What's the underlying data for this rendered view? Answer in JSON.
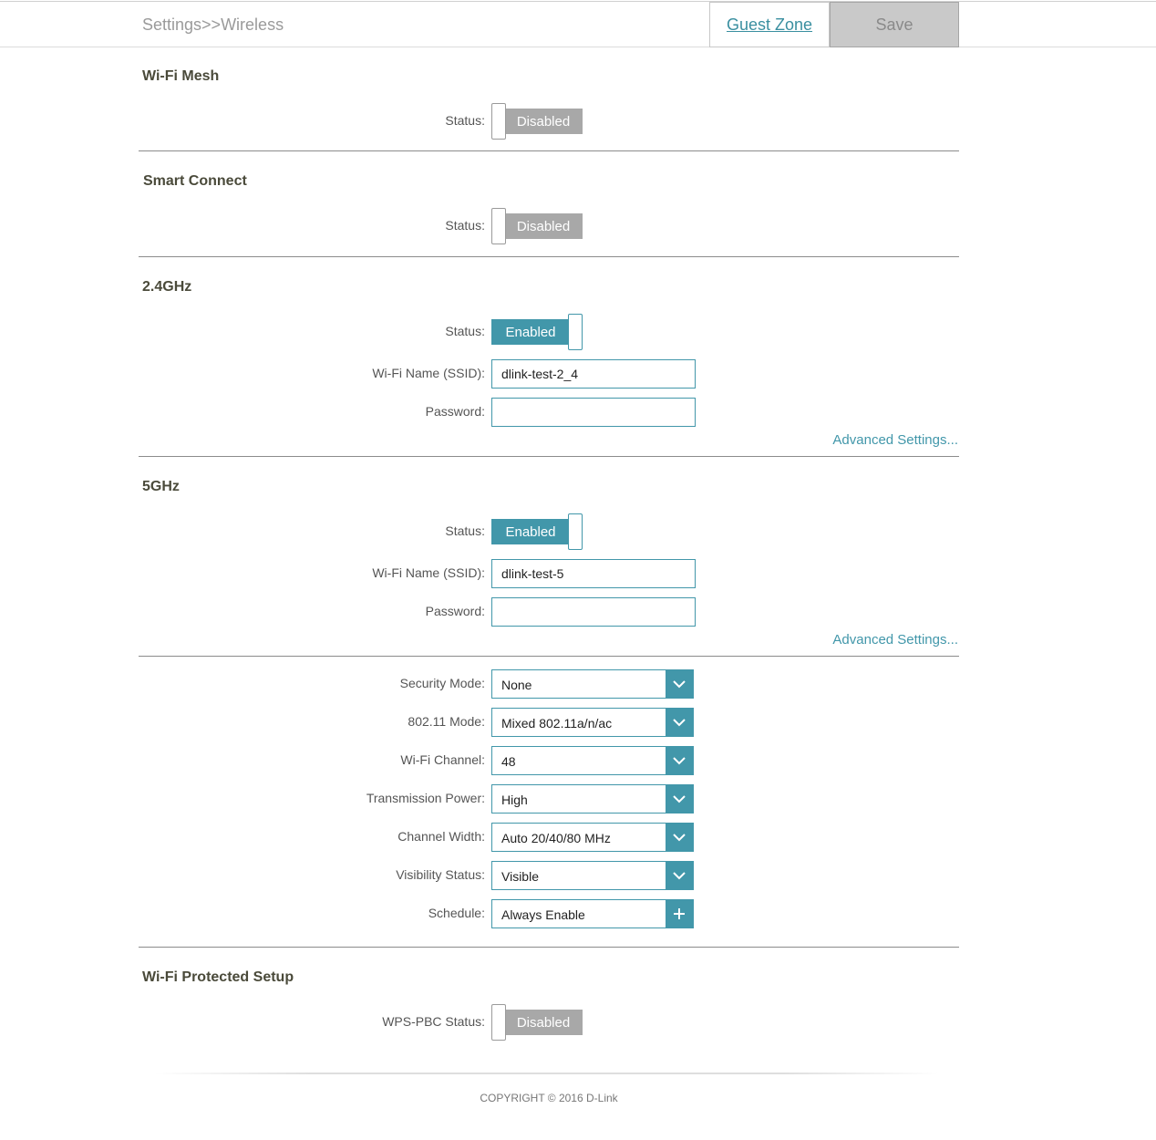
{
  "header": {
    "breadcrumb": "Settings>>Wireless",
    "guest_zone_label": "Guest Zone",
    "save_label": "Save"
  },
  "wifi_mesh": {
    "title": "Wi-Fi Mesh",
    "status_label": "Status:",
    "status_value": "Disabled"
  },
  "smart_connect": {
    "title": "Smart Connect",
    "status_label": "Status:",
    "status_value": "Disabled"
  },
  "band_24": {
    "title": "2.4GHz",
    "status_label": "Status:",
    "status_value": "Enabled",
    "ssid_label": "Wi-Fi Name (SSID):",
    "ssid_value": "dlink-test-2_4",
    "password_label": "Password:",
    "password_value": "",
    "advanced_label": "Advanced Settings..."
  },
  "band_5": {
    "title": "5GHz",
    "status_label": "Status:",
    "status_value": "Enabled",
    "ssid_label": "Wi-Fi Name (SSID):",
    "ssid_value": "dlink-test-5",
    "password_label": "Password:",
    "password_value": "",
    "advanced_label": "Advanced Settings..."
  },
  "advanced_5g": {
    "security_mode_label": "Security Mode:",
    "security_mode_value": "None",
    "mode_80211_label": "802.11 Mode:",
    "mode_80211_value": "Mixed 802.11a/n/ac",
    "channel_label": "Wi-Fi Channel:",
    "channel_value": "48",
    "tx_power_label": "Transmission Power:",
    "tx_power_value": "High",
    "channel_width_label": "Channel Width:",
    "channel_width_value": "Auto 20/40/80 MHz",
    "visibility_label": "Visibility Status:",
    "visibility_value": "Visible",
    "schedule_label": "Schedule:",
    "schedule_value": "Always Enable"
  },
  "wps": {
    "title": "Wi-Fi Protected Setup",
    "status_label": "WPS-PBC Status:",
    "status_value": "Disabled"
  },
  "footer": {
    "copyright": "COPYRIGHT © 2016 D-Link"
  },
  "colors": {
    "accent": "#4297aa",
    "disabled_toggle": "#a8a8a8",
    "save_button": "#c9c9c9"
  }
}
